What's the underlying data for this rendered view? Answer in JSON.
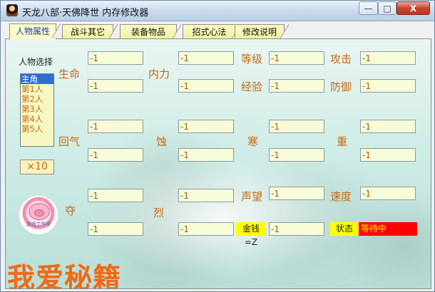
{
  "window": {
    "title": "天龙八部·天佛降世 内存修改器",
    "controls": {
      "minimize": "—",
      "maximize": "□",
      "close": "X"
    }
  },
  "tabs": [
    {
      "label": "人物属性",
      "active": true
    },
    {
      "label": "战斗其它",
      "active": false
    },
    {
      "label": "装备物品",
      "active": false
    },
    {
      "label": "招式心法",
      "active": false
    },
    {
      "label": "修改说明",
      "active": false
    }
  ],
  "character_select": {
    "label": "人物选择",
    "options": [
      "主角",
      "第1人",
      "第2人",
      "第3人",
      "第4人",
      "第5人"
    ],
    "selected": "主角",
    "multiplier_button": "×10"
  },
  "labels": {
    "hp": "生命",
    "mp": "内力",
    "level": "等级",
    "attack": "攻击",
    "exp": "经验",
    "defense": "防御",
    "recovery": "回气",
    "erosion": "蚀",
    "cold": "寒",
    "heavy": "重",
    "reputation": "声望",
    "speed": "速度",
    "seize": "夺",
    "fierce": "烈"
  },
  "fields": {
    "hp_current": "-1",
    "hp_max": "-1",
    "mp_current": "-1",
    "mp_max": "-1",
    "level": "-1",
    "attack": "-1",
    "exp": "-1",
    "defense": "-1",
    "recovery_1": "-1",
    "recovery_2": "-1",
    "erosion_1": "-1",
    "erosion_2": "-1",
    "cold_1": "-1",
    "cold_2": "-1",
    "heavy_1": "-1",
    "heavy_2": "-1",
    "reputation": "-1",
    "speed": "-1",
    "seize_1": "-1",
    "seize_2": "-1",
    "fierce_1": "-1",
    "fierce_2": "-1",
    "gold": "-1"
  },
  "status": {
    "gold_label": "金钱=Z",
    "state_label": "状态",
    "state_value": "等待中"
  },
  "logo": {
    "text": "游戏工作室"
  },
  "brand": "我爱秘籍",
  "colors": {
    "label": "#c86a12",
    "field_bg": "#f6fbd8",
    "tab_bg": "#fbfcc6",
    "active_tab_text": "#1a3fb0",
    "status_highlight": "#ffff00",
    "state_bg": "#ff0000",
    "brand": "#ef6a14"
  }
}
